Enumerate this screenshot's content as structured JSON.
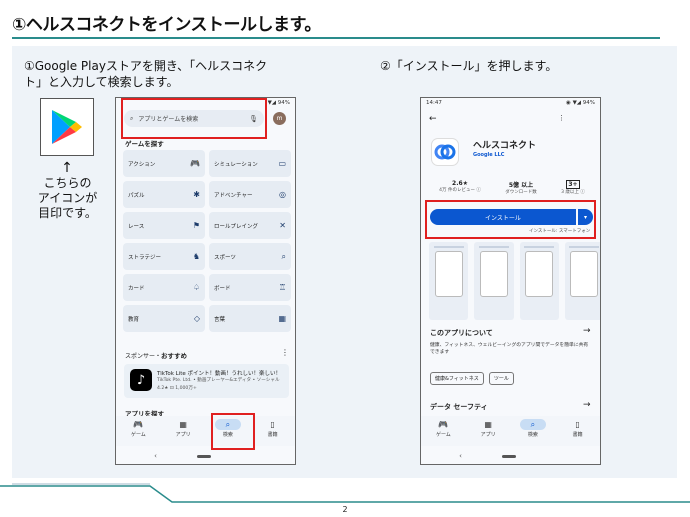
{
  "slide": {
    "title": "①ヘルスコネクトをインストールします。",
    "step1": "①Google Playストアを開き、「ヘルスコネクト」と入力して検索します。",
    "step2": "②「インストール」を押します。",
    "icon_caption_lines": [
      "こちらの",
      "アイコンが",
      "目印です。"
    ],
    "page_number": "2"
  },
  "phone1": {
    "status_right": "▼◢ 94%",
    "search_placeholder": "アプリとゲームを検索",
    "avatar_letter": "m",
    "section_title": "ゲームを探す",
    "categories": [
      {
        "label": "アクション",
        "icon": "🎮"
      },
      {
        "label": "シミュレーション",
        "icon": "▭"
      },
      {
        "label": "パズル",
        "icon": "✱"
      },
      {
        "label": "アドベンチャー",
        "icon": "◎"
      },
      {
        "label": "レース",
        "icon": "⚑"
      },
      {
        "label": "ロールプレイング",
        "icon": "✕"
      },
      {
        "label": "ストラテジー",
        "icon": "♞"
      },
      {
        "label": "スポーツ",
        "icon": "⌕"
      },
      {
        "label": "カード",
        "icon": "♤"
      },
      {
        "label": "ボード",
        "icon": "♖"
      },
      {
        "label": "教育",
        "icon": "◇"
      },
      {
        "label": "言葉",
        "icon": "▦"
      }
    ],
    "sponsor_prefix": "スポンサー・",
    "sponsor_title": "おすすめ",
    "ad": {
      "title": "TikTok Lite ポイント！動画！うれしい！楽しい！",
      "sub": "TikTok Pte. Ltd. • 動画プレーヤー&エディタ • ソーシャル",
      "meta": "4.2★  ⊡ 1,000万+"
    },
    "cut_text": "アプリを探す",
    "nav": [
      {
        "label": "ゲーム",
        "icon": "🎮",
        "active": false
      },
      {
        "label": "アプリ",
        "icon": "▦",
        "active": false
      },
      {
        "label": "検索",
        "icon": "⌕",
        "active": true
      },
      {
        "label": "書籍",
        "icon": "▯",
        "active": false
      }
    ]
  },
  "phone2": {
    "status_left": "14:47",
    "status_right": "◉ ▼◢ 94%",
    "app_name": "ヘルスコネクト",
    "developer": "Google LLC",
    "stats": [
      {
        "value": "2.6★",
        "label": "4万 件のレビュー ⓘ"
      },
      {
        "value": "5億 以上",
        "label": "ダウンロード数"
      },
      {
        "value": "3+",
        "label": "3 歳以上 ⓘ"
      }
    ],
    "install_label": "インストール",
    "install_note": "インストール: スマートフォン",
    "about_title": "このアプリについて",
    "about_desc": "健康、フィットネス、ウェルビーイングのアプリ間でデータを簡単に共有できます",
    "tags": [
      "健康&フィットネス",
      "ツール"
    ],
    "data_safety_title": "データ セーフティ",
    "nav": [
      {
        "label": "ゲーム",
        "icon": "🎮",
        "active": false
      },
      {
        "label": "アプリ",
        "icon": "▦",
        "active": false
      },
      {
        "label": "検索",
        "icon": "⌕",
        "active": true
      },
      {
        "label": "書籍",
        "icon": "▯",
        "active": false
      }
    ]
  },
  "colors": {
    "accent_teal": "#2a8c8c",
    "highlight_red": "#e02020",
    "play_blue": "#0b57d0"
  }
}
